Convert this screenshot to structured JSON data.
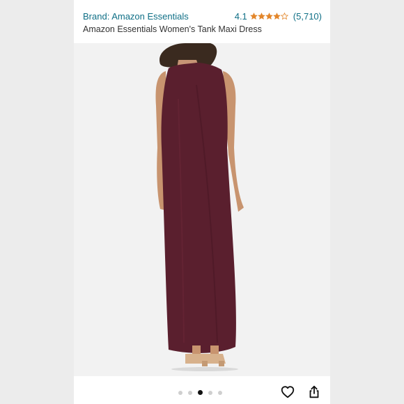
{
  "header": {
    "brand_label": "Brand: Amazon Essentials",
    "rating_value": "4.1",
    "rating_count": "(5,710)",
    "product_title": "Amazon Essentials Women's Tank Maxi Dress"
  },
  "rating": {
    "stars": 4.1,
    "max": 5
  },
  "carousel": {
    "total": 5,
    "current": 3
  },
  "actions": {
    "favorite_icon": "heart-icon",
    "share_icon": "share-icon"
  },
  "colors": {
    "link": "#0f6f86",
    "star": "#e3862a",
    "dress": "#5a1f2e"
  }
}
